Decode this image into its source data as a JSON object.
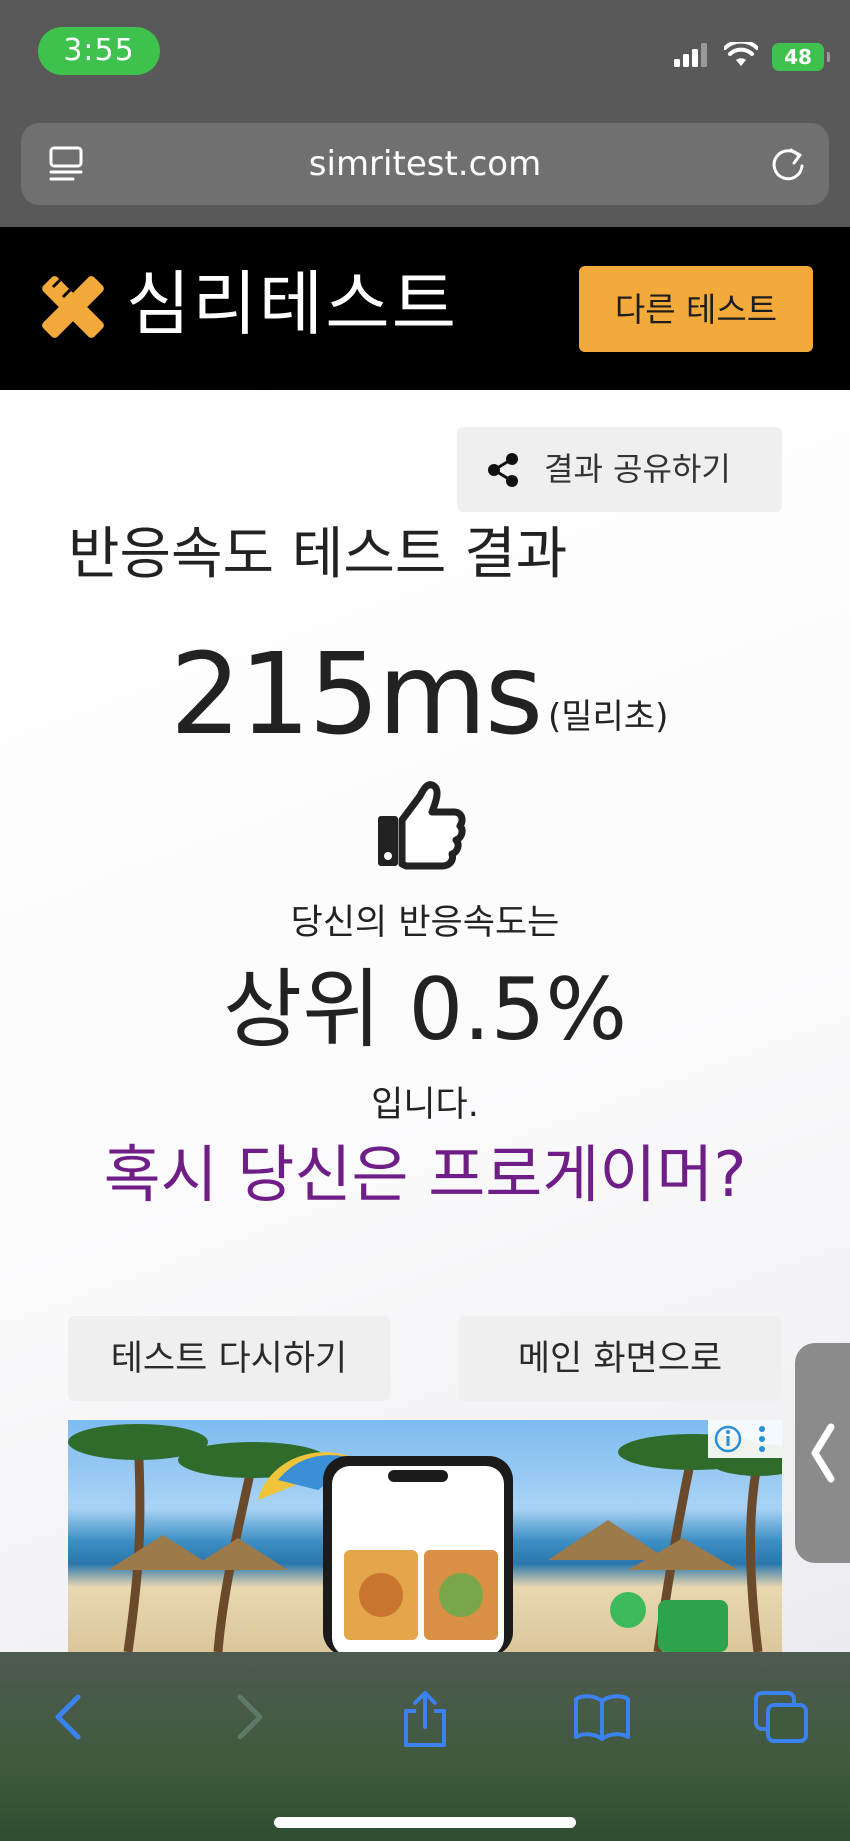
{
  "status_bar": {
    "time": "3:55",
    "battery": "48",
    "icons": [
      "signal-icon",
      "wifi-icon",
      "battery-icon"
    ]
  },
  "browser": {
    "url": "simritest.com",
    "icons": [
      "reader-mode-icon",
      "reload-icon"
    ]
  },
  "site": {
    "logo_text": "심리테스트",
    "other_tests_label": "다른 테스트",
    "brand_color": "#f4a93b"
  },
  "result": {
    "share_label": "결과 공유하기",
    "title": "반응속도 테스트 결과",
    "score": "215ms",
    "unit": "(밀리초)",
    "line1": "당신의 반응속도는",
    "rank": "상위 0.5%",
    "line3": "입니다.",
    "tagline": "혹시 당신은 프로게이머?",
    "tagline_color": "#6e1e86"
  },
  "actions": {
    "retry_label": "테스트 다시하기",
    "main_label": "메인 화면으로"
  },
  "bottom_toolbar": {
    "icons": [
      "back-icon",
      "forward-icon",
      "share-icon",
      "bookmarks-icon",
      "tabs-icon"
    ]
  }
}
